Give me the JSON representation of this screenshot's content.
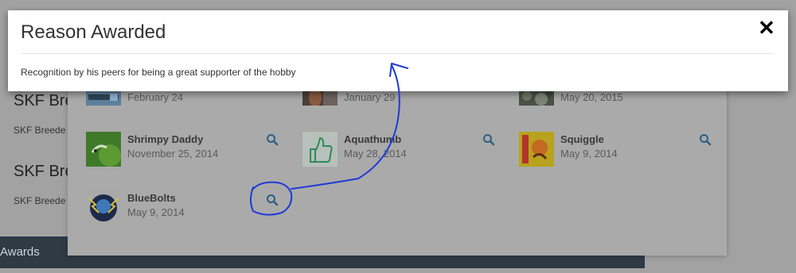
{
  "background": {
    "headings": [
      "SKF Bre",
      "SKF Bre"
    ],
    "subtexts": [
      "SKF Breede",
      "SKF Breede"
    ],
    "footer_label": "Awards"
  },
  "awards": [
    {
      "name": "",
      "date": "February 24",
      "icon": "award-banner-thumbnail"
    },
    {
      "name": "",
      "date": "January 29",
      "icon": "award-photo-thumbnail"
    },
    {
      "name": "",
      "date": "May 20, 2015",
      "icon": "award-photo-thumbnail"
    },
    {
      "name": "Shrimpy Daddy",
      "date": "November 25, 2014",
      "icon": "shrimp-photo-thumbnail",
      "has_details": true
    },
    {
      "name": "Aquathumb",
      "date": "May 28, 2014",
      "icon": "thumbs-up-thumbnail",
      "has_details": true
    },
    {
      "name": "Squiggle",
      "date": "May 9, 2014",
      "icon": "squiggle-badge-thumbnail",
      "has_details": true
    },
    {
      "name": "BlueBolts",
      "date": "May 9, 2014",
      "icon": "bluebolts-badge-thumbnail",
      "has_details": true
    }
  ],
  "modal": {
    "title": "Reason Awarded",
    "close_symbol": "✕",
    "body": "Recognition by his peers for being a great supporter of the hobby"
  },
  "colors": {
    "backdrop": "#a2a2a2",
    "footer": "#2e3a44",
    "accent_icon": "#2d5f82",
    "annotation_ink": "#1f3ad6"
  }
}
